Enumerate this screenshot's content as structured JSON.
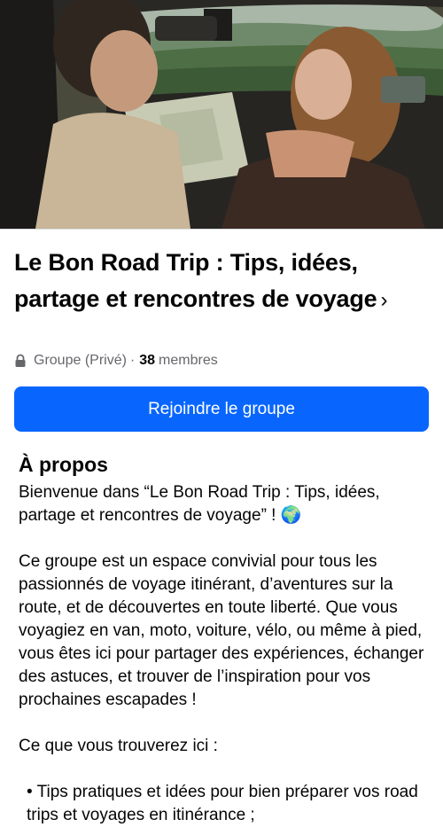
{
  "group": {
    "title": "Le Bon Road Trip : Tips, idées, partage et rencontres de voyage",
    "title_chevron": "›",
    "privacy": "Groupe (Privé)",
    "separator": "·",
    "member_count": "38",
    "members_label": "membres"
  },
  "actions": {
    "join_label": "Rejoindre le groupe"
  },
  "about": {
    "heading": "À propos",
    "intro": "Bienvenue dans “Le Bon Road Trip : Tips, idées, partage et rencontres de voyage” ! 🌍",
    "description": "Ce groupe est un espace convivial pour tous les passionnés de voyage itinérant, d’aventures sur la route, et de découvertes en toute liberté. Que vous voyagiez en van, moto, voiture, vélo, ou même à pied, vous êtes ici pour partager des expériences, échanger des astuces, et trouver de l’inspiration pour vos prochaines escapades !",
    "list_heading": "Ce que vous trouverez ici :",
    "bullet_1": "• Tips pratiques et idées pour bien préparer vos road trips et voyages en itinérance ;"
  },
  "colors": {
    "accent": "#0866ff",
    "secondary_text": "#65676b",
    "primary_text": "#050505"
  },
  "icons": {
    "privacy": "lock-icon",
    "chevron": "chevron-right-icon"
  }
}
